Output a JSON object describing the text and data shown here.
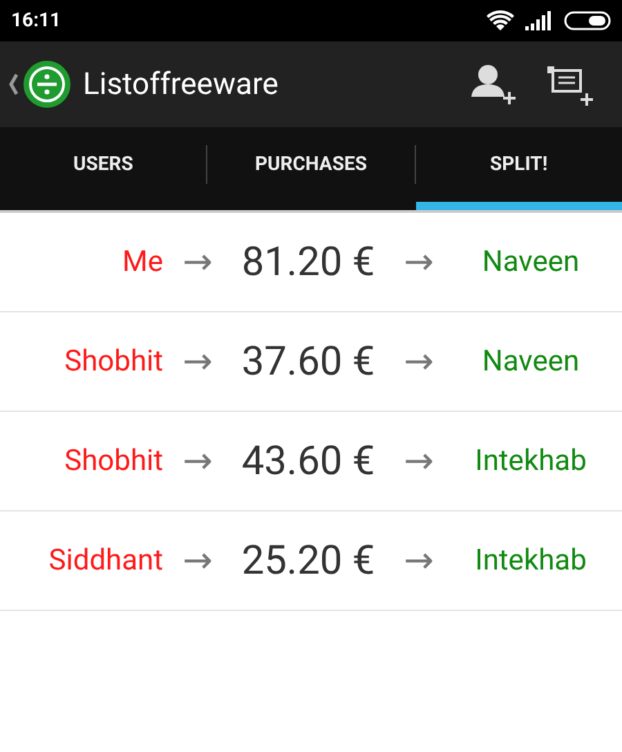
{
  "status_bar": {
    "time": "16:11"
  },
  "action_bar": {
    "title": "Listoffreeware"
  },
  "tabs": [
    {
      "label": "USERS",
      "selected": false
    },
    {
      "label": "PURCHASES",
      "selected": false
    },
    {
      "label": "SPLIT!",
      "selected": true
    }
  ],
  "transfers": [
    {
      "from": "Me",
      "arrow_1": "→",
      "amount": "81.20 €",
      "arrow_2": "→",
      "to": "Naveen"
    },
    {
      "from": "Shobhit",
      "arrow_1": "→",
      "amount": "37.60 €",
      "arrow_2": "→",
      "to": "Naveen"
    },
    {
      "from": "Shobhit",
      "arrow_1": "→",
      "amount": "43.60 €",
      "arrow_2": "→",
      "to": "Intekhab"
    },
    {
      "from": "Siddhant",
      "arrow_1": "→",
      "amount": "25.20 €",
      "arrow_2": "→",
      "to": "Intekhab"
    }
  ]
}
